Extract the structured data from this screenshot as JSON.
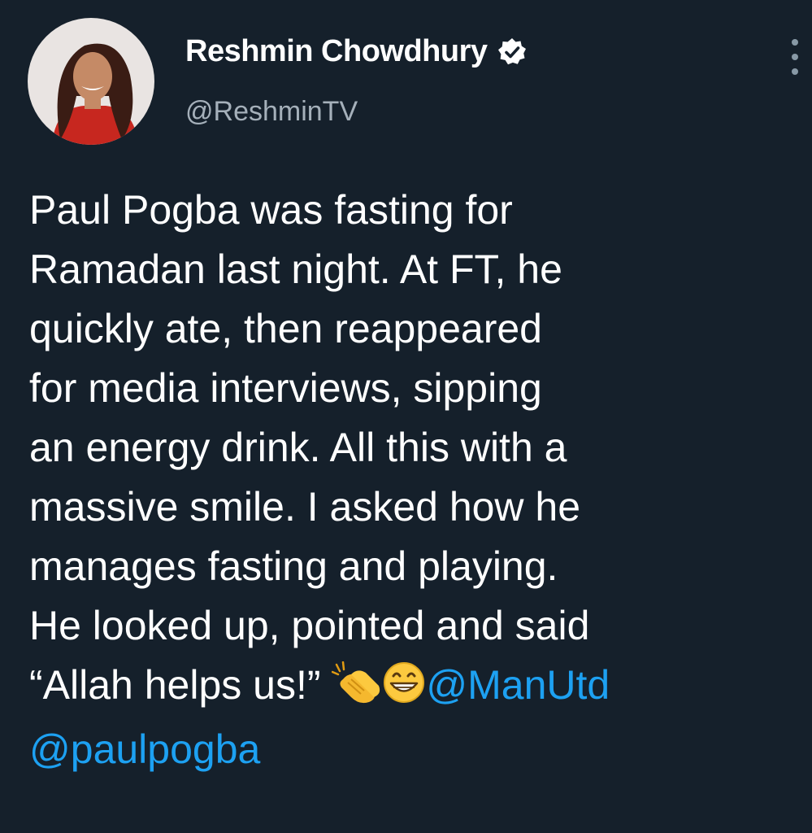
{
  "profile": {
    "display_name": "Reshmin Chowdhury",
    "handle": "@ReshminTV",
    "verified": true,
    "avatar_icon": "profile-photo",
    "verified_icon": "verified-badge-icon"
  },
  "menu": {
    "icon": "more-options-icon"
  },
  "tweet": {
    "text": "Paul Pogba was fasting for\nRamadan last night. At FT, he\nquickly ate, then reappeared\nfor media interviews, sipping\nan energy drink. All this with a\nmassive smile. I asked how he\nmanages fasting and playing.\nHe looked up, pointed and said\n“Allah helps us!” ",
    "emojis": [
      "clapping-hands-emoji",
      "grinning-face-emoji"
    ],
    "mention_1": "@ManUtd",
    "line_break": "\n",
    "mention_2": "@paulpogba"
  },
  "colors": {
    "background": "#15202b",
    "text": "#ffffff",
    "secondary_text": "#a5b0ba",
    "link": "#1da1f2"
  }
}
